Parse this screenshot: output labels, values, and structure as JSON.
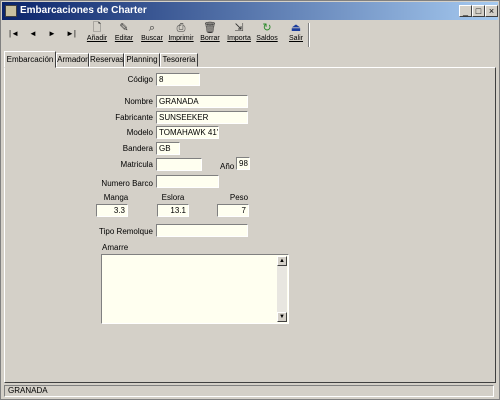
{
  "window": {
    "title": "Embarcaciones de Charter",
    "min": "_",
    "max": "□",
    "close": "×"
  },
  "toolbar": {
    "nav": [
      "|◄",
      "◄",
      "►",
      "►|"
    ],
    "buttons": [
      {
        "label": "Añadir",
        "icon": "new-doc-icon",
        "glyph": "🗋"
      },
      {
        "label": "Editar",
        "icon": "edit-icon",
        "glyph": "✎"
      },
      {
        "label": "Buscar",
        "icon": "search-icon",
        "glyph": "⌕"
      },
      {
        "label": "Imprimir",
        "icon": "printer-icon",
        "glyph": "⎙"
      },
      {
        "label": "Borrar",
        "icon": "trash-icon",
        "glyph": "🗑"
      },
      {
        "label": "Importa",
        "icon": "import-icon",
        "glyph": "⇲"
      },
      {
        "label": "Saldos",
        "icon": "balance-icon",
        "glyph": "↻"
      },
      {
        "label": "Salir",
        "icon": "exit-icon",
        "glyph": "⏏"
      }
    ]
  },
  "tabs": [
    "Embarcación",
    "Armador",
    "Reservas",
    "Planning",
    "Tesoreria"
  ],
  "form": {
    "codigo_label": "Código",
    "codigo": "8",
    "nombre_label": "Nombre",
    "nombre": "GRANADA",
    "fabricante_label": "Fabricante",
    "fabricante": "SUNSEEKER",
    "modelo_label": "Modelo",
    "modelo": "TOMAHAWK 41'",
    "bandera_label": "Bandera",
    "bandera": "GB",
    "matricula_label": "Matricula",
    "matricula": "",
    "anio_label": "Año",
    "anio": "98",
    "numero_barco_label": "Numero Barco",
    "numero_barco": "",
    "manga_label": "Manga",
    "manga": "3.3",
    "eslora_label": "Eslora",
    "eslora": "13.1",
    "peso_label": "Peso",
    "peso": "7",
    "tipo_remolque_label": "Tipo Remolque",
    "tipo_remolque": "",
    "amarre_label": "Amarre",
    "amarre": ""
  },
  "status": {
    "text": "GRANADA"
  }
}
